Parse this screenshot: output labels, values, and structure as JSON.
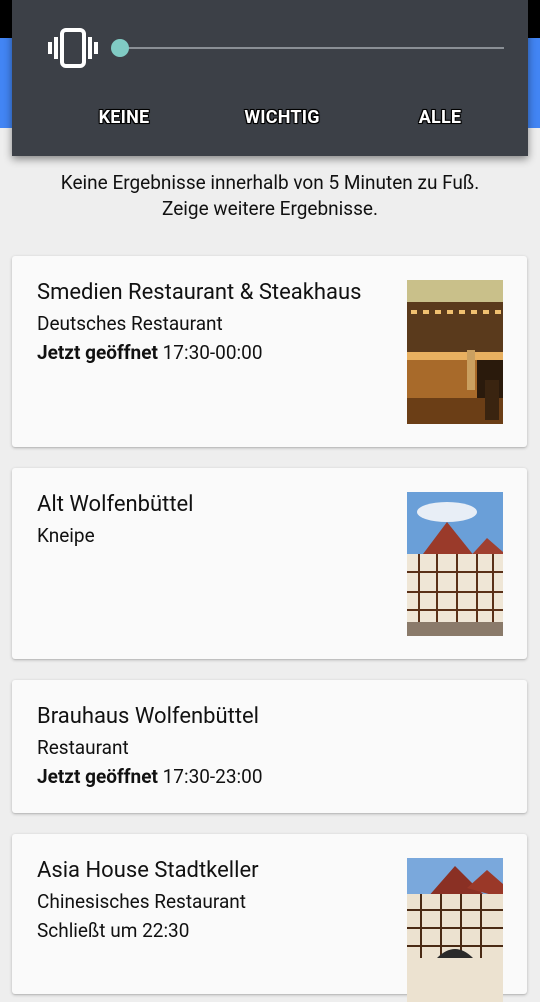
{
  "notification_panel": {
    "icon": "vibrate-icon",
    "buttons": {
      "none": "KEINE",
      "important": "WICHTIG",
      "all": "ALLE"
    }
  },
  "results": {
    "notice_line1": "Keine Ergebnisse innerhalb von 5 Minuten zu Fuß.",
    "notice_line2": "Zeige weitere Ergebnisse.",
    "items": [
      {
        "name": "Smedien Restaurant & Steakhaus",
        "category": "Deutsches Restaurant",
        "status_label": "Jetzt geöffnet",
        "hours": " 17:30-00:00"
      },
      {
        "name": "Alt Wolfenbüttel",
        "category": "Kneipe"
      },
      {
        "name": "Brauhaus Wolfenbüttel",
        "category": "Restaurant",
        "status_label": "Jetzt geöffnet",
        "hours": " 17:30-23:00"
      },
      {
        "name": "Asia House Stadtkeller",
        "category": "Chinesisches Restaurant",
        "hours": "Schließt um 22:30"
      }
    ]
  },
  "colors": {
    "panel_bg": "#3c4047",
    "slider_thumb": "#80cbc4",
    "app_bar": "#4285f4"
  }
}
